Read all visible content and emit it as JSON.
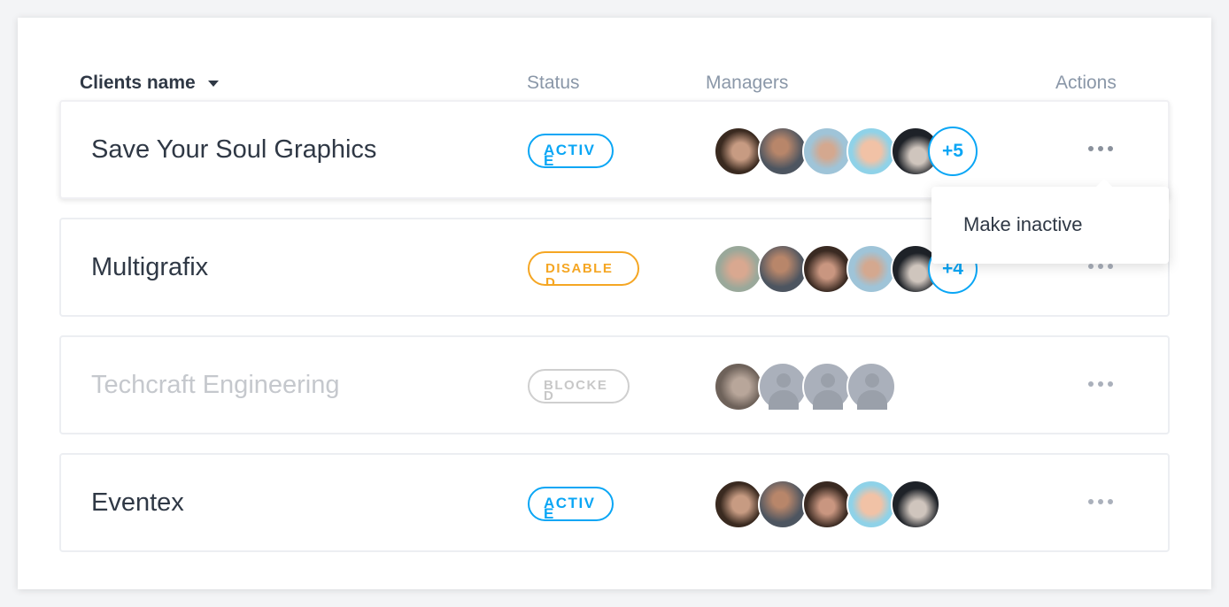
{
  "header": {
    "clients_name": "Clients name",
    "status": "Status",
    "managers": "Managers",
    "actions": "Actions"
  },
  "colors": {
    "active": "#0aa6f5",
    "disabled": "#f5a623",
    "blocked": "#c8c8c8"
  },
  "rows": [
    {
      "name": "Save Your Soul Graphics",
      "status": "ACTIVE",
      "more": "+5"
    },
    {
      "name": "Multigrafix",
      "status": "DISABLED",
      "more": "+4"
    },
    {
      "name": "Techcraft Engineering",
      "status": "BLOCKED",
      "more": null
    },
    {
      "name": "Eventex",
      "status": "ACTIVE",
      "more": null
    }
  ],
  "menu": {
    "make_inactive": "Make inactive"
  }
}
